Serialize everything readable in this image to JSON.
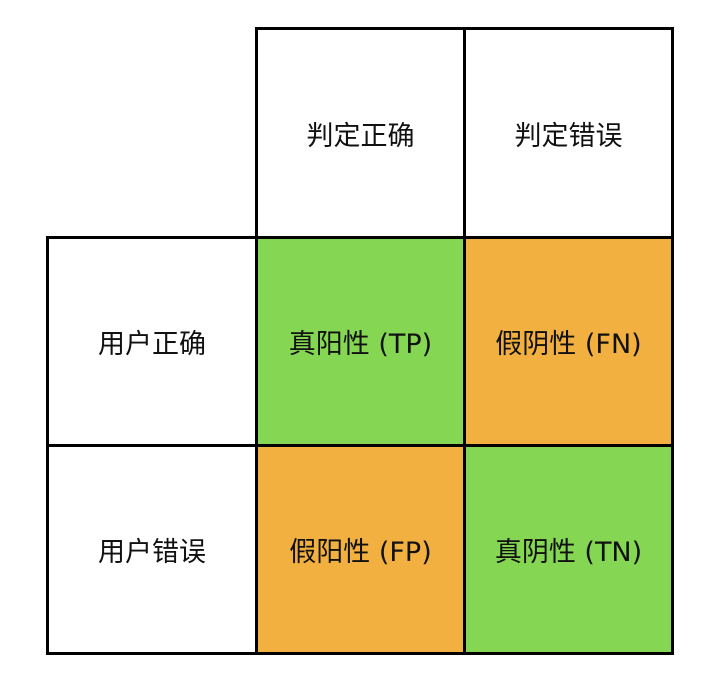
{
  "colors": {
    "positive_green": "#84d653",
    "false_orange": "#f1b040",
    "border": "#000000",
    "header_bg": "#ffffff"
  },
  "columns": [
    "判定正确",
    "判定错误"
  ],
  "rows": [
    "用户正确",
    "用户错误"
  ],
  "matrix": [
    [
      {
        "label": "真阳性 (TP)",
        "color": "#84d653"
      },
      {
        "label": "假阴性 (FN)",
        "color": "#f1b040"
      }
    ],
    [
      {
        "label": "假阳性 (FP)",
        "color": "#f1b040"
      },
      {
        "label": "真阴性 (TN)",
        "color": "#84d653"
      }
    ]
  ]
}
